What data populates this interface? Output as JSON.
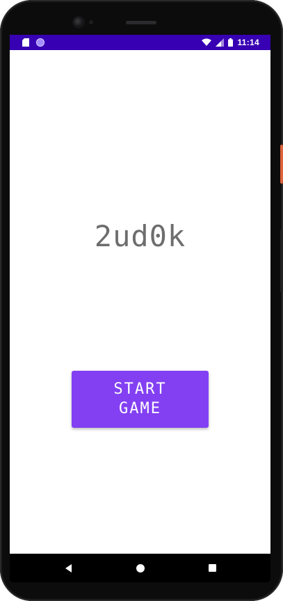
{
  "status_bar": {
    "time": "11:14",
    "left_icons": [
      "sd-card-icon",
      "notification-circle-icon"
    ],
    "right_icons": [
      "wifi-icon",
      "cellular-signal-icon",
      "battery-icon"
    ],
    "color": "#3700b3"
  },
  "app": {
    "title": "2ud0k",
    "start_button_label": "START\nGAME",
    "button_color": "#8340f2",
    "title_color": "#6d6d6d"
  },
  "nav_bar": {
    "buttons": [
      "back-icon",
      "home-icon",
      "recents-icon"
    ]
  }
}
